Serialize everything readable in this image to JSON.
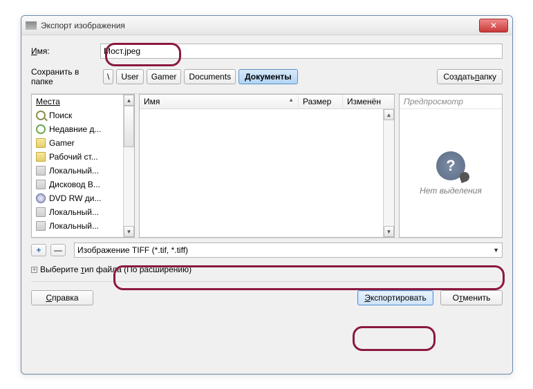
{
  "window": {
    "title": "Экспорт изображения"
  },
  "name": {
    "label_full": "Имя:",
    "value": "Мост.jpeg"
  },
  "save_in": {
    "label": "Сохранить в папке",
    "root": "\\",
    "crumbs": [
      "User",
      "Gamer",
      "Documents"
    ],
    "selected": "Документы"
  },
  "create_folder": "Создать папку",
  "places": {
    "header": "Места",
    "items": [
      {
        "icon": "search",
        "label": "Поиск"
      },
      {
        "icon": "recent",
        "label": "Недавние д..."
      },
      {
        "icon": "folder",
        "label": "Gamer"
      },
      {
        "icon": "folder",
        "label": "Рабочий ст..."
      },
      {
        "icon": "drive",
        "label": "Локальный..."
      },
      {
        "icon": "drive",
        "label": "Дисковод B..."
      },
      {
        "icon": "dvd",
        "label": "DVD RW ди..."
      },
      {
        "icon": "drive",
        "label": "Локальный..."
      },
      {
        "icon": "drive",
        "label": "Локальный..."
      }
    ]
  },
  "file_columns": {
    "name": "Имя",
    "size": "Размер",
    "modified": "Изменён"
  },
  "preview": {
    "header": "Предпросмотр",
    "empty_text": "Нет выделения"
  },
  "add": "+",
  "remove": "—",
  "filetype": {
    "value": "Изображение TIFF (*.tif, *.tiff)"
  },
  "expander": {
    "label": "Выберите тип файла (По расширению)"
  },
  "buttons": {
    "help": "Справка",
    "export": "Экспортировать",
    "cancel": "Отменить"
  }
}
